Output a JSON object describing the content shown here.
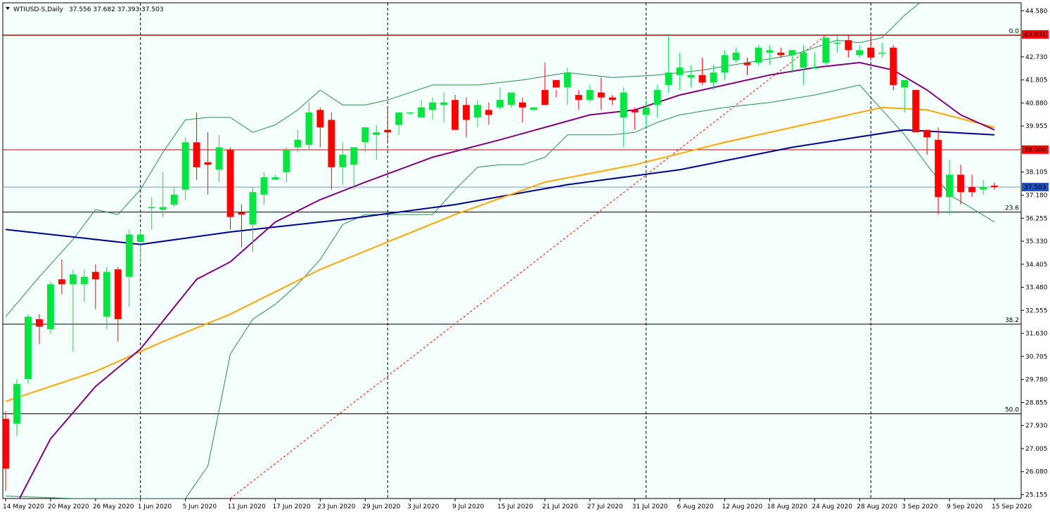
{
  "header": {
    "symbol": "WTIUSD-S,Daily",
    "ohlc": "37.556 37.682 37.393 37.503",
    "menu_icon": "triangle-down-icon"
  },
  "colors": {
    "background": "#f4fffb",
    "bull": "#00e640",
    "bear": "#ff0000",
    "ma_slow": "#00008b",
    "ma_mid": "#ffa500",
    "ma_fast": "#800080",
    "bands": "#2e8b57",
    "fib_trend": "#ff0000",
    "level_red": "#c00000"
  },
  "chart_data": {
    "type": "candlestick",
    "title": "WTIUSD-S,Daily",
    "ylim": [
      25.0,
      44.9
    ],
    "price_ticks": [
      "44.580",
      "43.631",
      "42.730",
      "41.805",
      "40.880",
      "39.955",
      "39.006",
      "38.105",
      "37.503",
      "37.180",
      "36.255",
      "35.330",
      "34.405",
      "33.480",
      "32.555",
      "31.630",
      "30.705",
      "29.780",
      "28.855",
      "27.930",
      "27.005",
      "26.080",
      "25.155"
    ],
    "date_labels": [
      "14 May 2020",
      "20 May 2020",
      "26 May 2020",
      "1 Jun 2020",
      "5 Jun 2020",
      "11 Jun 2020",
      "17 Jun 2020",
      "23 Jun 2020",
      "29 Jun 2020",
      "3 Jul 2020",
      "9 Jul 2020",
      "15 Jul 2020",
      "21 Jul 2020",
      "27 Jul 2020",
      "31 Jul 2020",
      "6 Aug 2020",
      "12 Aug 2020",
      "18 Aug 2020",
      "24 Aug 2020",
      "28 Aug 2020",
      "3 Sep 2020",
      "9 Sep 2020",
      "15 Sep 2020"
    ],
    "date_label_index": [
      0,
      4,
      8,
      12,
      16,
      20,
      24,
      28,
      32,
      36,
      40,
      44,
      48,
      52,
      56,
      60,
      64,
      68,
      72,
      76,
      80,
      84,
      88
    ],
    "separator_index": [
      12,
      34,
      57,
      77
    ],
    "candles": [
      [
        28.2,
        28.5,
        25.3,
        26.2
      ],
      [
        28.0,
        29.8,
        27.5,
        29.6
      ],
      [
        29.8,
        32.4,
        29.6,
        32.3
      ],
      [
        32.2,
        32.4,
        31.2,
        31.9
      ],
      [
        31.8,
        33.7,
        31.6,
        33.6
      ],
      [
        33.8,
        34.6,
        33.2,
        33.6
      ],
      [
        33.6,
        34.2,
        30.9,
        34.0
      ],
      [
        33.6,
        34.2,
        32.9,
        33.9
      ],
      [
        34.1,
        34.4,
        32.6,
        33.8
      ],
      [
        32.3,
        34.3,
        31.8,
        34.1
      ],
      [
        34.2,
        34.3,
        31.3,
        32.2
      ],
      [
        33.9,
        35.8,
        32.7,
        35.6
      ],
      [
        35.3,
        35.8,
        34.4,
        35.6
      ],
      [
        36.7,
        37.1,
        35.8,
        36.7
      ],
      [
        36.6,
        38.1,
        36.3,
        36.7
      ],
      [
        36.8,
        37.5,
        36.7,
        37.2
      ],
      [
        37.4,
        39.5,
        37.0,
        39.3
      ],
      [
        39.3,
        40.5,
        37.8,
        38.3
      ],
      [
        38.5,
        39.7,
        37.2,
        38.4
      ],
      [
        38.2,
        39.6,
        37.7,
        39.1
      ],
      [
        39.0,
        39.1,
        35.8,
        36.3
      ],
      [
        36.5,
        36.8,
        35.1,
        36.4
      ],
      [
        36.0,
        37.5,
        34.9,
        37.3
      ],
      [
        37.2,
        38.1,
        36.8,
        37.9
      ],
      [
        37.8,
        38.0,
        37.8,
        37.9
      ],
      [
        38.1,
        39.1,
        37.7,
        39.0
      ],
      [
        39.1,
        39.8,
        38.9,
        39.4
      ],
      [
        39.2,
        40.9,
        39.0,
        40.5
      ],
      [
        40.6,
        40.7,
        39.1,
        39.9
      ],
      [
        40.2,
        40.5,
        37.4,
        38.3
      ],
      [
        38.3,
        39.3,
        37.6,
        38.8
      ],
      [
        38.4,
        39.1,
        37.4,
        39.1
      ],
      [
        39.3,
        39.8,
        38.9,
        39.9
      ],
      [
        39.6,
        40.0,
        38.6,
        39.7
      ],
      [
        39.8,
        40.7,
        39.3,
        39.7
      ],
      [
        40.0,
        40.3,
        39.6,
        40.5
      ],
      [
        40.5,
        40.5,
        40.4,
        40.5
      ],
      [
        40.3,
        41.0,
        40.4,
        40.7
      ],
      [
        40.6,
        41.1,
        40.2,
        40.9
      ],
      [
        40.8,
        41.3,
        40.1,
        40.9
      ],
      [
        41.0,
        41.2,
        39.8,
        39.8
      ],
      [
        40.8,
        41.1,
        39.5,
        40.2
      ],
      [
        40.3,
        41.0,
        39.9,
        40.8
      ],
      [
        40.6,
        40.9,
        40.0,
        40.4
      ],
      [
        40.7,
        41.5,
        40.6,
        41.0
      ],
      [
        40.8,
        41.2,
        40.7,
        41.3
      ],
      [
        40.9,
        41.1,
        40.1,
        40.7
      ],
      [
        40.6,
        40.7,
        40.6,
        40.7
      ],
      [
        41.4,
        42.5,
        40.9,
        40.8
      ],
      [
        41.8,
        41.4,
        41.1,
        41.5
      ],
      [
        41.5,
        42.3,
        40.8,
        42.1
      ],
      [
        41.2,
        41.4,
        40.6,
        41.0
      ],
      [
        41.0,
        41.6,
        40.9,
        41.4
      ],
      [
        41.3,
        41.9,
        40.6,
        41.1
      ],
      [
        41.1,
        41.2,
        40.8,
        41.0
      ],
      [
        40.3,
        41.5,
        39.1,
        41.3
      ],
      [
        40.6,
        40.7,
        39.8,
        40.5
      ],
      [
        40.4,
        41.0,
        39.9,
        40.7
      ],
      [
        40.8,
        41.6,
        40.3,
        41.4
      ],
      [
        41.6,
        43.6,
        41.3,
        42.1
      ],
      [
        42.0,
        42.9,
        41.4,
        42.3
      ],
      [
        41.9,
        42.4,
        41.5,
        42.0
      ],
      [
        42.0,
        42.7,
        41.6,
        41.7
      ],
      [
        41.7,
        42.4,
        41.4,
        42.1
      ],
      [
        42.1,
        43.0,
        41.8,
        42.8
      ],
      [
        42.6,
        43.1,
        42.5,
        42.9
      ],
      [
        42.5,
        42.7,
        42.0,
        42.4
      ],
      [
        42.5,
        43.2,
        42.4,
        43.1
      ],
      [
        42.9,
        43.2,
        42.4,
        43.0
      ],
      [
        42.9,
        43.1,
        42.7,
        42.8
      ],
      [
        42.8,
        43.0,
        42.1,
        43.0
      ],
      [
        42.3,
        43.2,
        41.6,
        42.9
      ],
      [
        42.3,
        42.9,
        42.3,
        42.3
      ],
      [
        42.5,
        43.5,
        42.4,
        43.5
      ],
      [
        43.3,
        43.6,
        42.9,
        43.3
      ],
      [
        43.4,
        43.6,
        42.7,
        43.0
      ],
      [
        42.8,
        43.2,
        42.7,
        43.0
      ],
      [
        43.1,
        43.7,
        42.6,
        42.7
      ],
      [
        42.9,
        43.3,
        42.7,
        42.9
      ],
      [
        43.1,
        43.2,
        41.4,
        41.6
      ],
      [
        41.5,
        41.8,
        40.5,
        41.8
      ],
      [
        41.4,
        41.4,
        39.8,
        39.7
      ],
      [
        39.8,
        39.6,
        38.8,
        39.5
      ],
      [
        39.4,
        39.9,
        36.4,
        37.1
      ],
      [
        37.1,
        38.6,
        36.4,
        38.0
      ],
      [
        38.0,
        38.4,
        36.8,
        37.3
      ],
      [
        37.5,
        38.0,
        37.1,
        37.3
      ],
      [
        37.4,
        37.8,
        37.2,
        37.5
      ],
      [
        37.56,
        37.68,
        37.39,
        37.5
      ]
    ],
    "ma_slow": [
      [
        0,
        35.8
      ],
      [
        12,
        35.2
      ],
      [
        20,
        35.7
      ],
      [
        30,
        36.2
      ],
      [
        40,
        36.8
      ],
      [
        50,
        37.6
      ],
      [
        60,
        38.2
      ],
      [
        70,
        39.1
      ],
      [
        80,
        39.8
      ],
      [
        88,
        39.6
      ]
    ],
    "ma_mid": [
      [
        0,
        28.9
      ],
      [
        8,
        30.1
      ],
      [
        14,
        31.3
      ],
      [
        20,
        32.4
      ],
      [
        28,
        34.2
      ],
      [
        34,
        35.3
      ],
      [
        40,
        36.4
      ],
      [
        48,
        37.7
      ],
      [
        56,
        38.4
      ],
      [
        64,
        39.3
      ],
      [
        72,
        40.1
      ],
      [
        78,
        40.7
      ],
      [
        82,
        40.6
      ],
      [
        88,
        39.9
      ]
    ],
    "ma_fast": [
      [
        1,
        24.8
      ],
      [
        4,
        27.4
      ],
      [
        8,
        29.5
      ],
      [
        12,
        31.0
      ],
      [
        17,
        33.8
      ],
      [
        20,
        34.5
      ],
      [
        24,
        36.1
      ],
      [
        28,
        37.0
      ],
      [
        32,
        37.7
      ],
      [
        38,
        38.7
      ],
      [
        44,
        39.4
      ],
      [
        48,
        39.9
      ],
      [
        52,
        40.4
      ],
      [
        56,
        40.6
      ],
      [
        60,
        41.2
      ],
      [
        64,
        41.6
      ],
      [
        68,
        42.0
      ],
      [
        72,
        42.3
      ],
      [
        76,
        42.5
      ],
      [
        79,
        42.2
      ],
      [
        82,
        41.4
      ],
      [
        85,
        40.4
      ],
      [
        88,
        39.8
      ]
    ],
    "band_upper": [
      [
        0,
        32.3
      ],
      [
        3,
        33.9
      ],
      [
        6,
        35.4
      ],
      [
        8,
        36.6
      ],
      [
        10,
        36.4
      ],
      [
        12,
        37.4
      ],
      [
        14,
        38.9
      ],
      [
        16,
        40.2
      ],
      [
        18,
        40.3
      ],
      [
        20,
        40.3
      ],
      [
        22,
        39.7
      ],
      [
        24,
        40.0
      ],
      [
        26,
        40.6
      ],
      [
        28,
        41.4
      ],
      [
        30,
        40.8
      ],
      [
        32,
        40.8
      ],
      [
        34,
        41.0
      ],
      [
        38,
        41.6
      ],
      [
        42,
        41.6
      ],
      [
        46,
        41.8
      ],
      [
        50,
        42.1
      ],
      [
        54,
        41.9
      ],
      [
        58,
        42.0
      ],
      [
        62,
        42.2
      ],
      [
        66,
        42.5
      ],
      [
        70,
        42.8
      ],
      [
        74,
        43.4
      ],
      [
        76,
        43.3
      ],
      [
        78,
        43.5
      ],
      [
        80,
        44.4
      ],
      [
        83,
        45.5
      ]
    ],
    "band_lower": [
      [
        0,
        25.1
      ],
      [
        6,
        25.0
      ],
      [
        10,
        25.0
      ],
      [
        12,
        25.0
      ],
      [
        14,
        25.0
      ],
      [
        16,
        25.0
      ],
      [
        18,
        26.3
      ],
      [
        20,
        30.8
      ],
      [
        22,
        32.2
      ],
      [
        24,
        32.8
      ],
      [
        26,
        33.6
      ],
      [
        28,
        34.6
      ],
      [
        30,
        36.0
      ],
      [
        32,
        36.4
      ],
      [
        34,
        36.4
      ],
      [
        36,
        36.4
      ],
      [
        38,
        36.4
      ],
      [
        40,
        37.4
      ],
      [
        42,
        38.3
      ],
      [
        44,
        38.4
      ],
      [
        46,
        38.4
      ],
      [
        48,
        38.7
      ],
      [
        50,
        39.6
      ],
      [
        54,
        39.6
      ],
      [
        56,
        39.7
      ],
      [
        58,
        40.1
      ],
      [
        60,
        40.4
      ],
      [
        64,
        40.7
      ],
      [
        68,
        40.9
      ],
      [
        72,
        41.2
      ],
      [
        76,
        41.6
      ],
      [
        80,
        39.6
      ],
      [
        84,
        37.2
      ],
      [
        88,
        36.1
      ]
    ],
    "fib_levels": [
      {
        "label": "0.0",
        "price": 43.6
      },
      {
        "label": "23.6",
        "price": 36.5
      },
      {
        "label": "38.2",
        "price": 32.0
      },
      {
        "label": "50.0",
        "price": 28.4
      }
    ],
    "level_red": 39.0,
    "price_line": 37.503,
    "fib_trend": [
      [
        20,
        25.0
      ],
      [
        73,
        43.6
      ]
    ],
    "tags": [
      {
        "text": "43.631",
        "price": 43.631,
        "color": "#ff0000"
      },
      {
        "text": "39.006",
        "price": 39.006,
        "color": "#ff0000"
      },
      {
        "text": "37.503",
        "price": 37.503,
        "color": "#1e50c8"
      }
    ]
  }
}
